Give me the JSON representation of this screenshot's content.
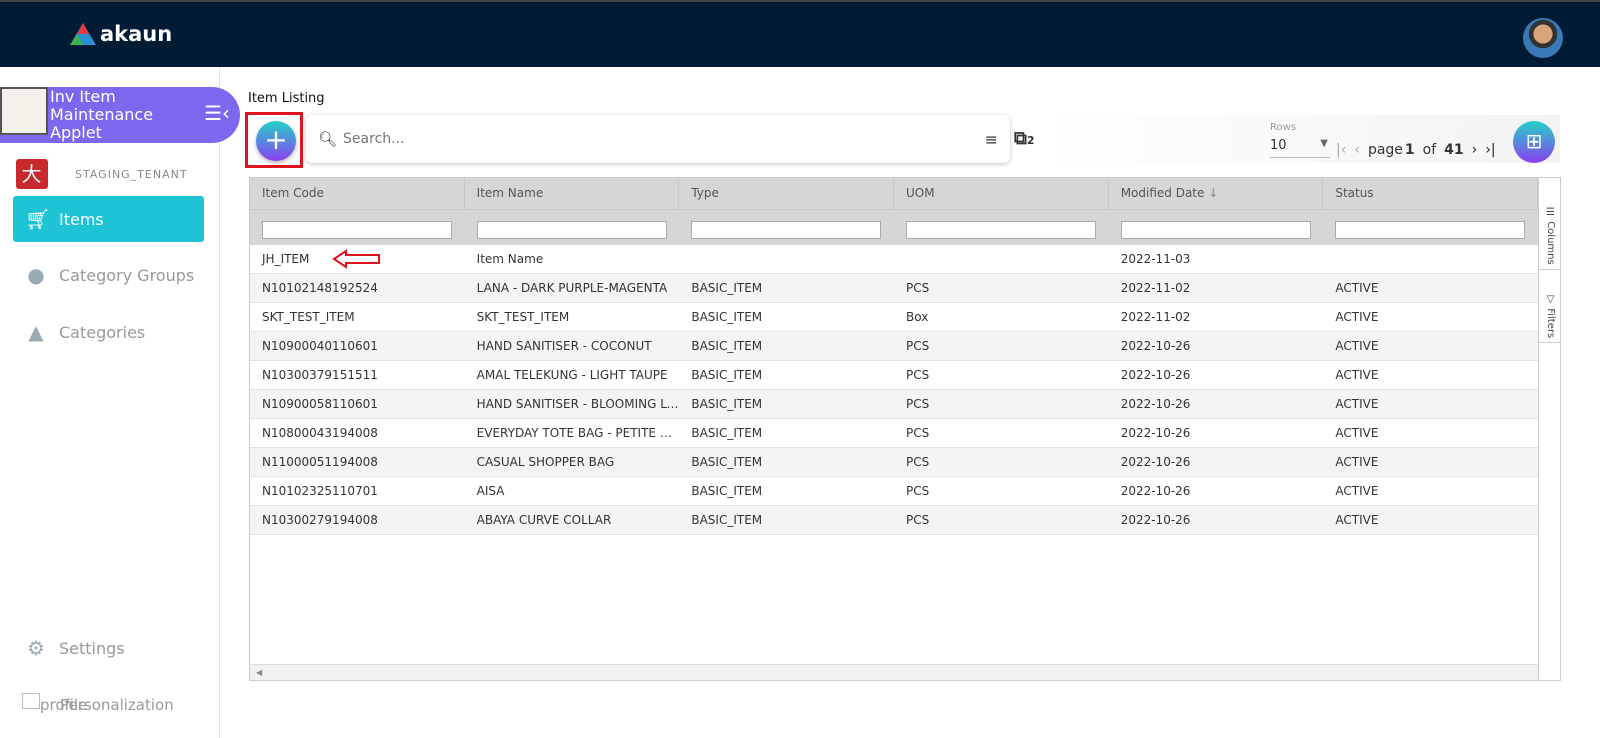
{
  "header": {
    "brand": "akaun"
  },
  "sidebar": {
    "applet_title": "Inv Item Maintenance Applet",
    "tenant": "STAGING_TENANT",
    "items": [
      {
        "label": "Items",
        "icon": "cart-icon",
        "active": true
      },
      {
        "label": "Category Groups",
        "icon": "circles-icon"
      },
      {
        "label": "Categories",
        "icon": "shapes-icon"
      }
    ],
    "settings": "Settings",
    "personalization": "Personalization",
    "profile": "profile"
  },
  "main": {
    "title": "Item Listing",
    "search_placeholder": "Search...",
    "rows_label": "Rows",
    "rows_value": "10",
    "page_label": "page",
    "page": "1",
    "of_label": "of",
    "total_pages": "41",
    "stack_count": "2"
  },
  "table": {
    "columns": [
      "Item Code",
      "Item Name",
      "Type",
      "UOM",
      "Modified Date",
      "Status"
    ],
    "sort_indicator": "↓",
    "rows": [
      [
        "JH_ITEM",
        "Item Name",
        "",
        "",
        "2022-11-03",
        ""
      ],
      [
        "N10102148192524",
        "LANA - DARK PURPLE-MAGENTA",
        "BASIC_ITEM",
        "PCS",
        "2022-11-02",
        "ACTIVE"
      ],
      [
        "SKT_TEST_ITEM",
        "SKT_TEST_ITEM",
        "BASIC_ITEM",
        "Box",
        "2022-11-02",
        "ACTIVE"
      ],
      [
        "N10900040110601",
        "HAND SANITISER - COCONUT",
        "BASIC_ITEM",
        "PCS",
        "2022-10-26",
        "ACTIVE"
      ],
      [
        "N10300379151511",
        "AMAL TELEKUNG - LIGHT TAUPE",
        "BASIC_ITEM",
        "PCS",
        "2022-10-26",
        "ACTIVE"
      ],
      [
        "N10900058110601",
        "HAND SANITISER - BLOOMING LOTUS",
        "BASIC_ITEM",
        "PCS",
        "2022-10-26",
        "ACTIVE"
      ],
      [
        "N10800043194008",
        "EVERYDAY TOTE BAG - PETITE CAMEL",
        "BASIC_ITEM",
        "PCS",
        "2022-10-26",
        "ACTIVE"
      ],
      [
        "N11000051194008",
        "CASUAL SHOPPER BAG",
        "BASIC_ITEM",
        "PCS",
        "2022-10-26",
        "ACTIVE"
      ],
      [
        "N10102325110701",
        "AISA",
        "BASIC_ITEM",
        "PCS",
        "2022-10-26",
        "ACTIVE"
      ],
      [
        "N10300279194008",
        "ABAYA CURVE COLLAR",
        "BASIC_ITEM",
        "PCS",
        "2022-10-26",
        "ACTIVE"
      ]
    ],
    "side_tabs": [
      "Columns",
      "Filters"
    ]
  },
  "colors": {
    "header": "#021b35",
    "applet": "#7b68ee",
    "active_nav": "#1fc3d6",
    "highlight": "#e0141e"
  }
}
